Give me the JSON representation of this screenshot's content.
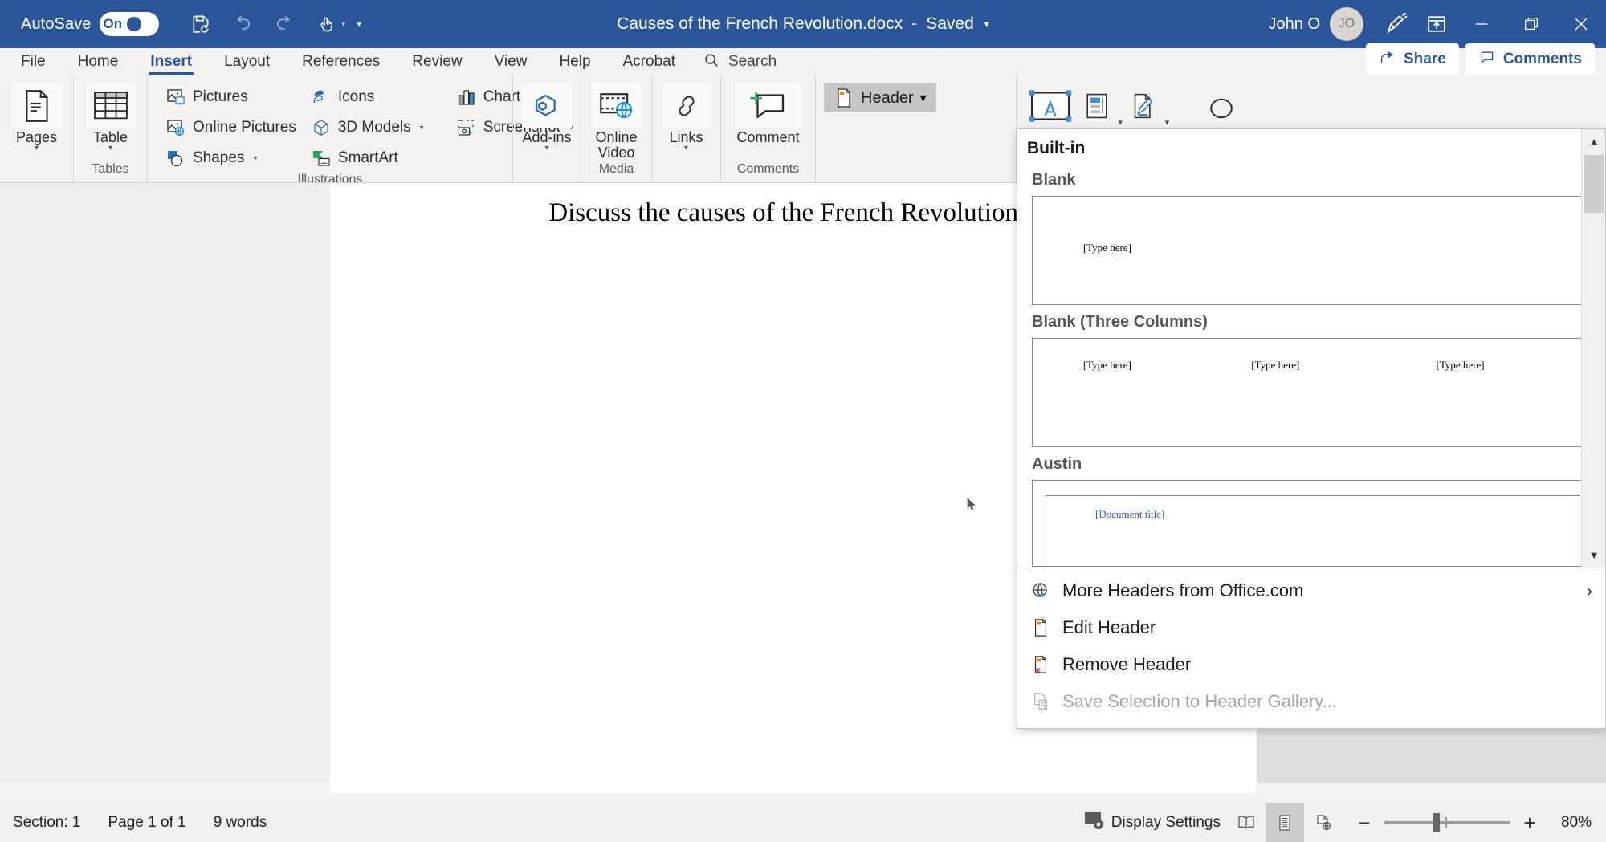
{
  "titlebar": {
    "autosave_label": "AutoSave",
    "autosave_state": "On",
    "quick_access": [
      {
        "name": "save-icon",
        "tooltip": "Save"
      },
      {
        "name": "undo-icon",
        "tooltip": "Undo"
      },
      {
        "name": "redo-icon",
        "tooltip": "Redo"
      },
      {
        "name": "touch-mode-icon",
        "tooltip": "Touch/Mouse Mode"
      }
    ],
    "qat_more": "▾",
    "document_name": "Causes of the French Revolution.docx",
    "separator": "-",
    "save_state": "Saved",
    "title_caret": "▾",
    "account_name": "John O",
    "account_initials": "JO",
    "ribbon_display_icon": "ribbon-display-options-icon",
    "minimize": "—",
    "restore": "restore-icon",
    "close": "✕",
    "bg_color": "#2b579a"
  },
  "tabs": [
    {
      "label": "File",
      "active": false
    },
    {
      "label": "Home",
      "active": false
    },
    {
      "label": "Insert",
      "active": true
    },
    {
      "label": "Layout",
      "active": false
    },
    {
      "label": "References",
      "active": false
    },
    {
      "label": "Review",
      "active": false
    },
    {
      "label": "View",
      "active": false
    },
    {
      "label": "Help",
      "active": false
    },
    {
      "label": "Acrobat",
      "active": false
    }
  ],
  "search": {
    "label": "Search"
  },
  "header_actions": {
    "share_label": "Share",
    "comments_label": "Comments"
  },
  "ribbon": {
    "groups": [
      {
        "label": "",
        "name": "pages-group",
        "big": [
          {
            "label": "Pages",
            "icon": "pages-icon",
            "caret": "▾"
          }
        ]
      },
      {
        "label": "Tables",
        "name": "tables-group",
        "big": [
          {
            "label": "Table",
            "icon": "table-icon",
            "caret": "▾"
          }
        ]
      },
      {
        "label": "Illustrations",
        "name": "illustrations-group",
        "small": [
          {
            "label": "Pictures",
            "icon": "pictures-icon",
            "caret": ""
          },
          {
            "label": "Online Pictures",
            "icon": "online-pictures-icon",
            "caret": ""
          },
          {
            "label": "Shapes",
            "icon": "shapes-icon",
            "caret": "▾"
          },
          {
            "label": "Icons",
            "icon": "icons-icon",
            "caret": ""
          },
          {
            "label": "3D Models",
            "icon": "3d-models-icon",
            "caret": "▾"
          },
          {
            "label": "SmartArt",
            "icon": "smartart-icon",
            "caret": ""
          },
          {
            "label": "Chart",
            "icon": "chart-icon",
            "caret": ""
          },
          {
            "label": "Screenshot",
            "icon": "screenshot-icon",
            "caret": "▾"
          }
        ]
      },
      {
        "label": "",
        "name": "addins-group",
        "big": [
          {
            "label": "Add-ins",
            "icon": "add-ins-icon",
            "caret": "▾"
          }
        ]
      },
      {
        "label": "Media",
        "name": "media-group",
        "big": [
          {
            "label": "Online Video",
            "icon": "online-video-icon",
            "caret": ""
          }
        ]
      },
      {
        "label": "",
        "name": "links-group",
        "big": [
          {
            "label": "Links",
            "icon": "links-icon",
            "caret": "▾"
          }
        ]
      },
      {
        "label": "Comments",
        "name": "comments-group",
        "big": [
          {
            "label": "Comment",
            "icon": "new-comment-icon",
            "caret": ""
          }
        ]
      }
    ],
    "header_button": {
      "label": "Header",
      "caret": "▾",
      "icon": "header-icon",
      "pressed": true
    },
    "right_icons": [
      {
        "name": "text-box-icon",
        "caret": ""
      },
      {
        "name": "quick-parts-icon",
        "caret": "▾"
      },
      {
        "name": "signature-line-icon",
        "caret": "▾"
      },
      {
        "name": "equation-icon",
        "caret": ""
      }
    ]
  },
  "document": {
    "text": "Discuss the causes of the French Revolution o"
  },
  "gallery": {
    "title": "Built-in",
    "items": [
      {
        "label": "Blank",
        "placeholders": [
          {
            "text": "[Type here]",
            "left_pct": 9
          }
        ]
      },
      {
        "label": "Blank (Three Columns)",
        "placeholders": [
          {
            "text": "[Type here]",
            "left_pct": 9
          },
          {
            "text": "[Type here]",
            "left_pct": 39
          },
          {
            "text": "[Type here]",
            "left_pct": 72
          }
        ]
      },
      {
        "label": "Austin",
        "placeholders": [
          {
            "text": "[Document title]",
            "left_pct": 11
          }
        ]
      }
    ],
    "menu": [
      {
        "label": "More Headers from Office.com",
        "icon": "office-online-icon",
        "chevron": "›",
        "disabled": false
      },
      {
        "label": "Edit Header",
        "icon": "edit-header-icon",
        "chevron": "",
        "disabled": false
      },
      {
        "label": "Remove Header",
        "icon": "remove-header-icon",
        "chevron": "",
        "disabled": false
      },
      {
        "label": "Save Selection to Header Gallery...",
        "icon": "save-selection-icon",
        "chevron": "",
        "disabled": true
      }
    ],
    "scroll_up": "▲",
    "scroll_down": "▼"
  },
  "statusbar": {
    "section": "Section: 1",
    "page": "Page 1 of 1",
    "words": "9 words",
    "display_settings": "Display Settings",
    "views": [
      {
        "name": "read-mode-icon",
        "active": false
      },
      {
        "name": "print-layout-icon",
        "active": true
      },
      {
        "name": "web-layout-icon",
        "active": false
      }
    ],
    "zoom_out": "−",
    "zoom_in": "+",
    "zoom_level": "80%"
  }
}
